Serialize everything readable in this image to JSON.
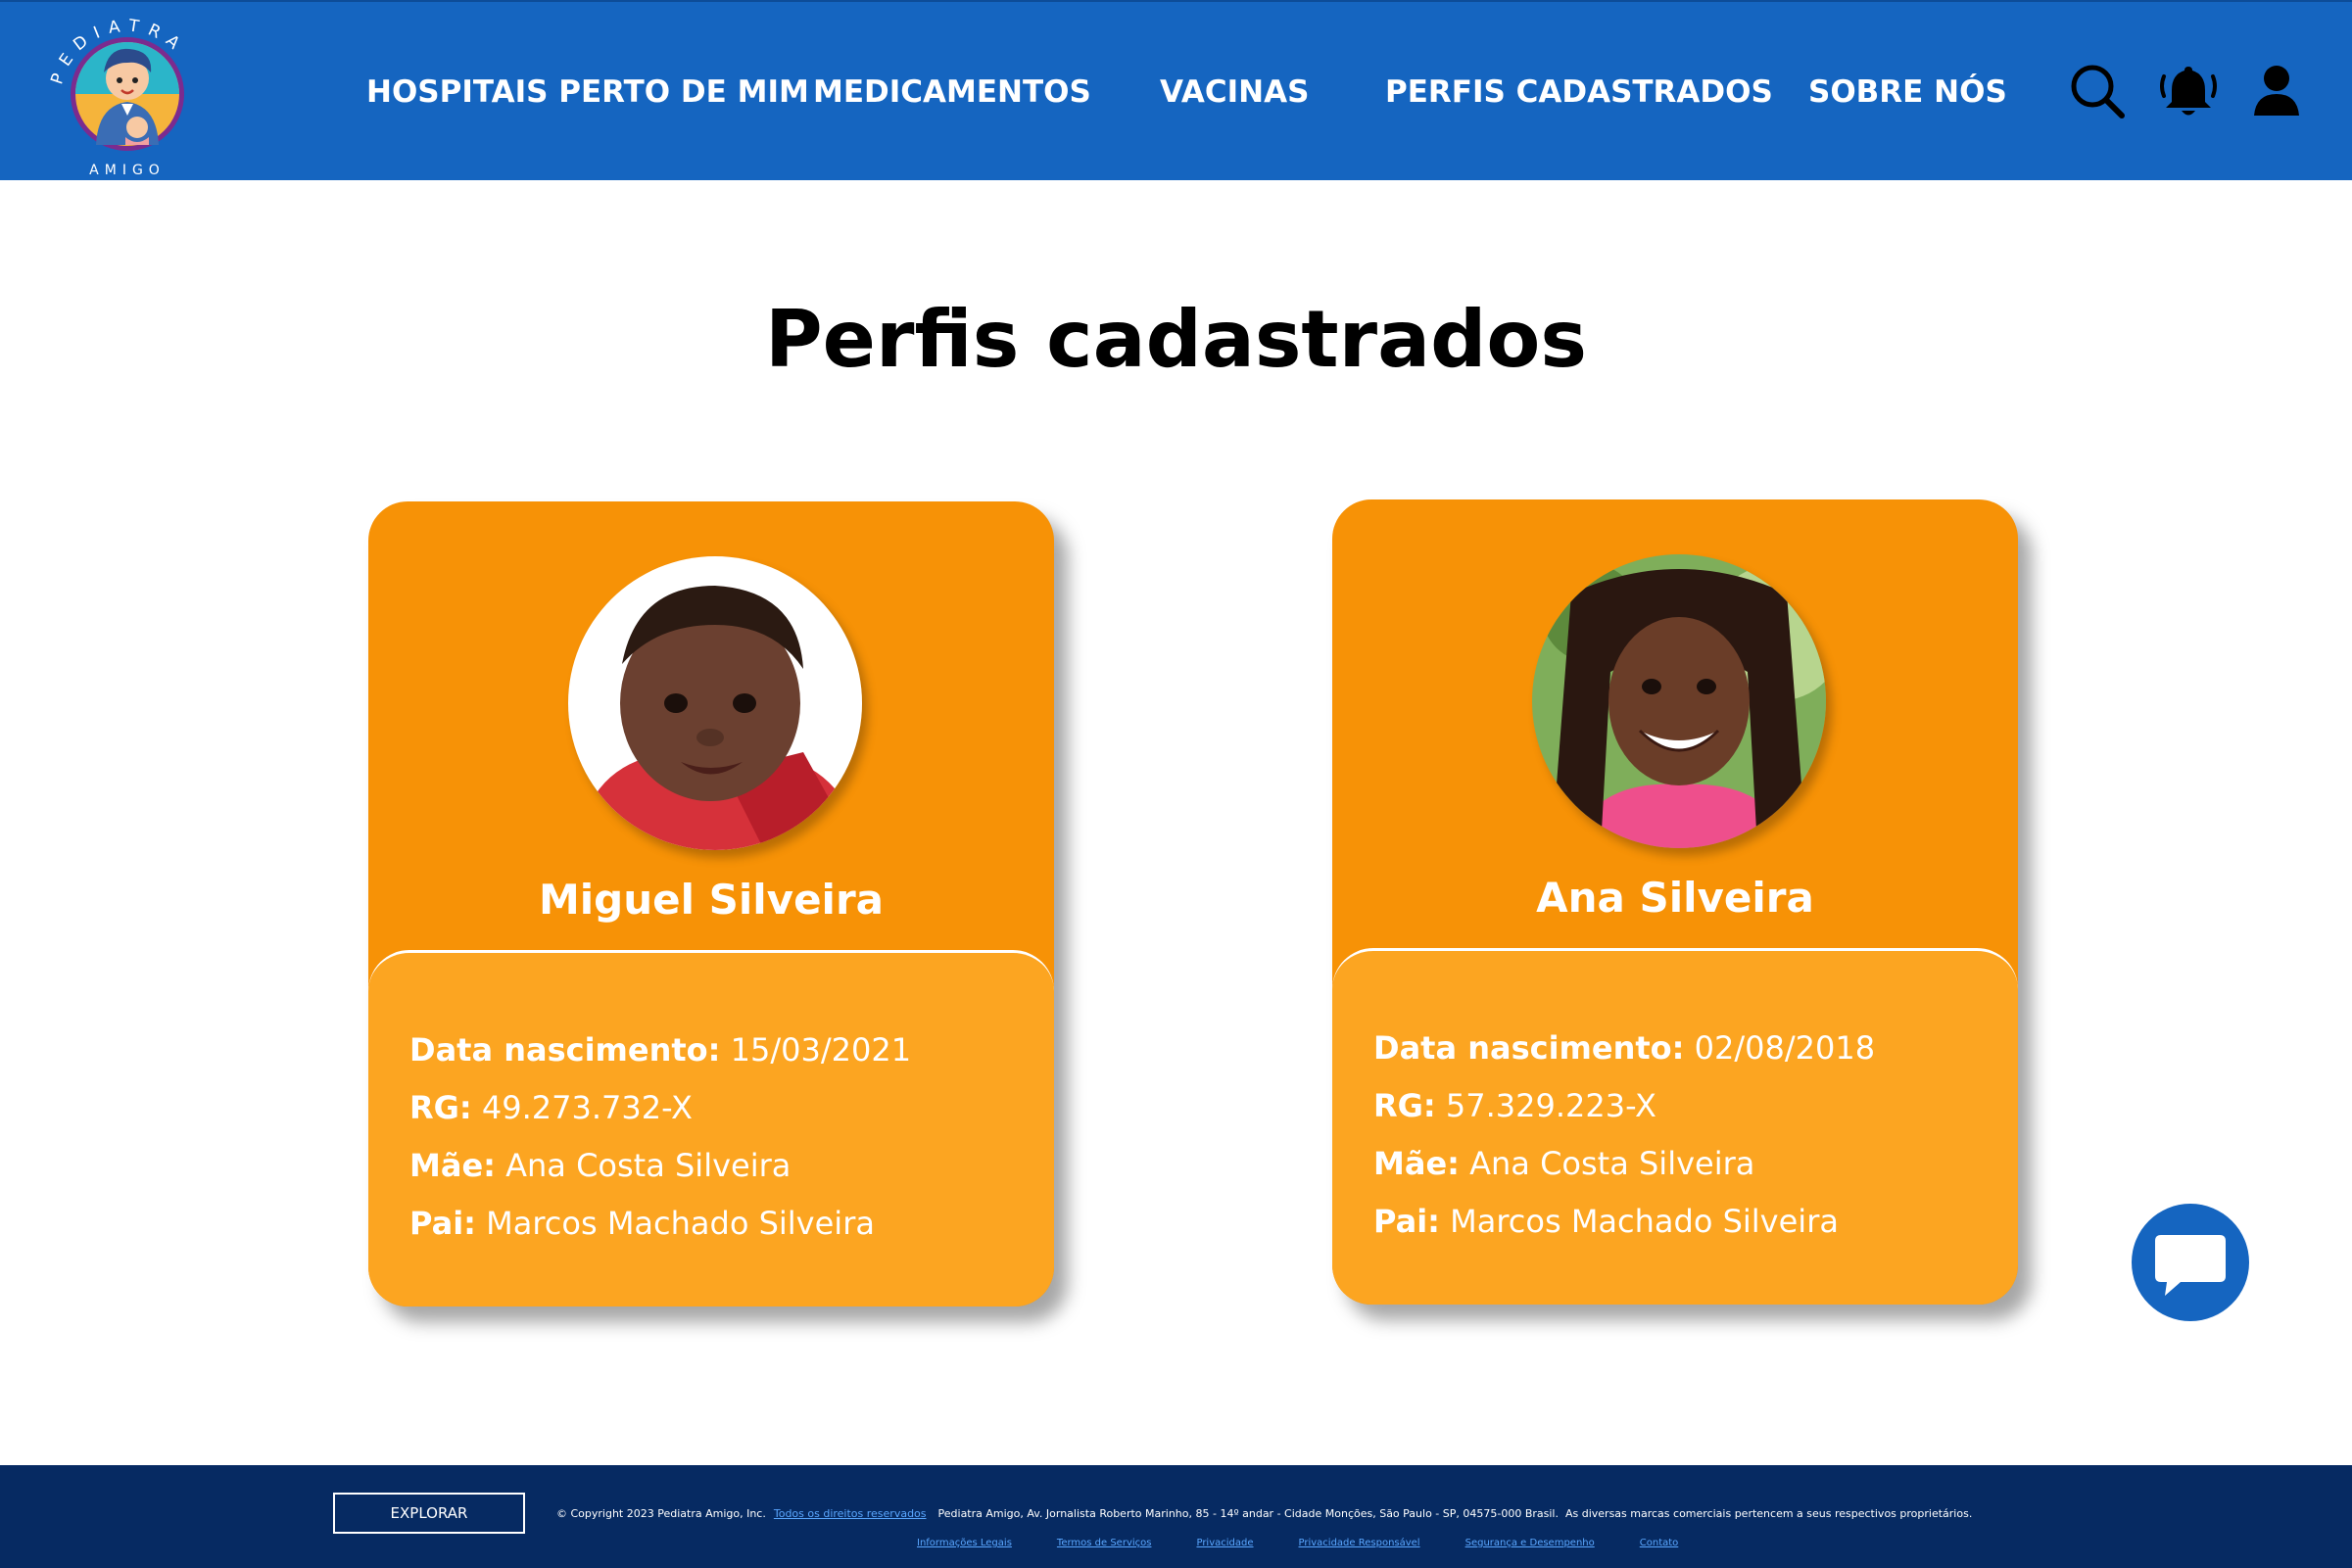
{
  "logo": {
    "top_text": "PEDIATRA",
    "bottom_text": "AMIGO"
  },
  "nav": {
    "items": [
      {
        "label": "HOSPITAIS PERTO DE MIM"
      },
      {
        "label": "MEDICAMENTOS"
      },
      {
        "label": "VACINAS"
      },
      {
        "label": "PERFIS CADASTRADOS"
      },
      {
        "label": "SOBRE NÓS"
      }
    ],
    "icons": [
      "search-icon",
      "bell-icon",
      "user-icon"
    ]
  },
  "page": {
    "title": "Perfis cadastrados"
  },
  "profiles": [
    {
      "name": "Miguel Silveira",
      "birth_label": "Data nascimento:",
      "birth": "15/03/2021",
      "rg_label": "RG:",
      "rg": "49.273.732-X",
      "mother_label": "Mãe:",
      "mother": "Ana Costa Silveira",
      "father_label": "Pai:",
      "father": "Marcos Machado Silveira"
    },
    {
      "name": "Ana Silveira",
      "birth_label": "Data nascimento:",
      "birth": "02/08/2018",
      "rg_label": "RG:",
      "rg": "57.329.223-X",
      "mother_label": "Mãe:",
      "mother": "Ana Costa Silveira",
      "father_label": "Pai:",
      "father": "Marcos Machado Silveira"
    }
  ],
  "chat": {
    "icon": "chat-icon"
  },
  "footer": {
    "explore": "EXPLORAR",
    "copyright": "© Copyright 2023 Pediatra Amigo, Inc.",
    "rights_link": "Todos os direitos reservados",
    "address": "Pediatra Amigo, Av. Jornalista Roberto Marinho, 85 - 14º andar - Cidade Monções, São Paulo - SP, 04575-000 Brasil.",
    "brands": "As diversas marcas comerciais pertencem a seus respectivos proprietários.",
    "links": [
      "Informações Legais",
      "Termos de Serviços",
      "Privacidade",
      "Privacidade Responsável",
      "Segurança e Desempenho",
      "Contato"
    ]
  },
  "colors": {
    "header": "#1565c0",
    "card": "#f79206",
    "card_info": "#fca521",
    "footer": "#062a62"
  }
}
